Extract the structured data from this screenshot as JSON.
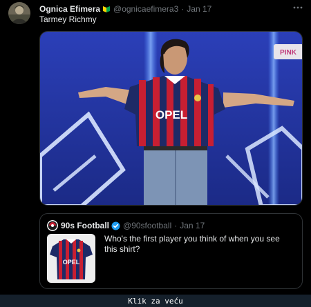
{
  "tweet": {
    "author_name": "Ognica Efimera",
    "author_handle": "@ognicaefimera3",
    "separator": "·",
    "date": "Jan 17",
    "text": "Tarmey Richmy",
    "media": {
      "sign_text": "PINK",
      "shirt_sponsor": "OPEL"
    }
  },
  "quote": {
    "author_name": "90s Football",
    "author_handle": "@90sfootball",
    "separator": "·",
    "date": "Jan 17",
    "text": "Who's the first player you think of when you see this shirt?",
    "thumb_sponsor": "OPEL"
  },
  "footer": {
    "link_label": "Klik za veću"
  },
  "colors": {
    "background": "#000000",
    "page": "#15202b",
    "text": "#e7e9ea",
    "muted": "#71767b",
    "verified": "#1d9bf0",
    "border": "#2f3336"
  },
  "icons": {
    "more": "more-dots-icon",
    "badge": "beginner-badge-icon",
    "verified": "verified-check-icon"
  }
}
